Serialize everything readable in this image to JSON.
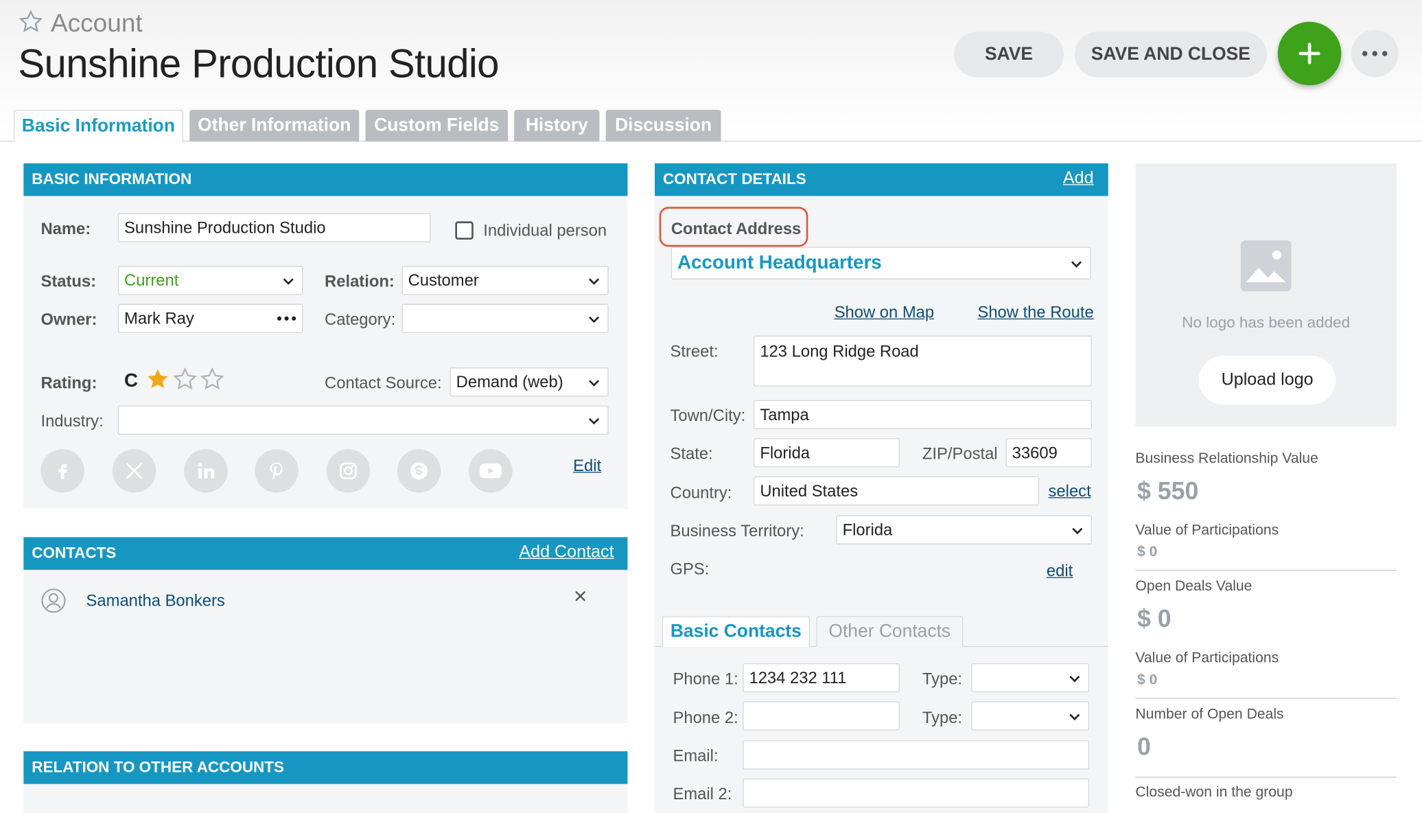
{
  "header": {
    "entity_type": "Account",
    "title": "Sunshine Production Studio",
    "save_label": "SAVE",
    "save_close_label": "SAVE AND CLOSE"
  },
  "tabs": [
    {
      "label": "Basic Information"
    },
    {
      "label": "Other Information"
    },
    {
      "label": "Custom Fields"
    },
    {
      "label": "History"
    },
    {
      "label": "Discussion"
    }
  ],
  "basic": {
    "heading": "BASIC INFORMATION",
    "name_label": "Name:",
    "name_value": "Sunshine Production Studio",
    "individual_label": "Individual person",
    "status_label": "Status:",
    "status_value": "Current",
    "relation_label": "Relation:",
    "relation_value": "Customer",
    "owner_label": "Owner:",
    "owner_value": "Mark Ray",
    "category_label": "Category:",
    "category_value": "",
    "rating_label": "Rating:",
    "rating_value": "C",
    "rating_stars": 1,
    "rating_max": 3,
    "contact_source_label": "Contact Source:",
    "contact_source_value": "Demand (web)",
    "industry_label": "Industry:",
    "industry_value": "",
    "edit_label": "Edit",
    "social_icons": [
      "facebook-icon",
      "x-icon",
      "linkedin-icon",
      "pinterest-icon",
      "instagram-icon",
      "skype-icon",
      "youtube-icon"
    ]
  },
  "contacts": {
    "heading": "CONTACTS",
    "add_label": "Add Contact",
    "items": [
      {
        "name": "Samantha Bonkers"
      }
    ]
  },
  "relation": {
    "heading": "RELATION TO OTHER ACCOUNTS"
  },
  "contact_details": {
    "heading": "CONTACT DETAILS",
    "add_label": "Add",
    "address_label": "Contact Address",
    "address_select": "Account Headquarters",
    "show_map": "Show on Map",
    "show_route": "Show the Route",
    "street_label": "Street:",
    "street_value": "123 Long Ridge Road",
    "town_label": "Town/City:",
    "town_value": "Tampa",
    "state_label": "State:",
    "state_value": "Florida",
    "zip_label": "ZIP/Postal",
    "zip_value": "33609",
    "country_label": "Country:",
    "country_value": "United States",
    "select_label": "select",
    "territory_label": "Business Territory:",
    "territory_value": "Florida",
    "gps_label": "GPS:",
    "gps_edit": "edit",
    "subtabs": [
      {
        "label": "Basic Contacts"
      },
      {
        "label": "Other Contacts"
      }
    ],
    "phone1_label": "Phone 1:",
    "phone1_value": "1234 232 111",
    "type_label": "Type:",
    "phone2_label": "Phone 2:",
    "phone2_value": "",
    "email_label": "Email:",
    "email_value": "",
    "email2_label": "Email 2:",
    "email2_value": ""
  },
  "logo": {
    "empty_text": "No logo has been added",
    "upload_label": "Upload logo"
  },
  "kpis": {
    "brv_label": "Business Relationship Value",
    "brv_value": "$ 550",
    "vop1_label": "Value of Participations",
    "vop1_value": "$ 0",
    "odv_label": "Open Deals Value",
    "odv_value": "$ 0",
    "vop2_label": "Value of Participations",
    "vop2_value": "$ 0",
    "nod_label": "Number of Open Deals",
    "nod_value": "0",
    "cw_label": "Closed-won in the group"
  },
  "colors": {
    "accent": "#1697c2",
    "add_button": "#3fa21b",
    "status_current": "#3fa21b",
    "highlight": "#e4533c"
  }
}
